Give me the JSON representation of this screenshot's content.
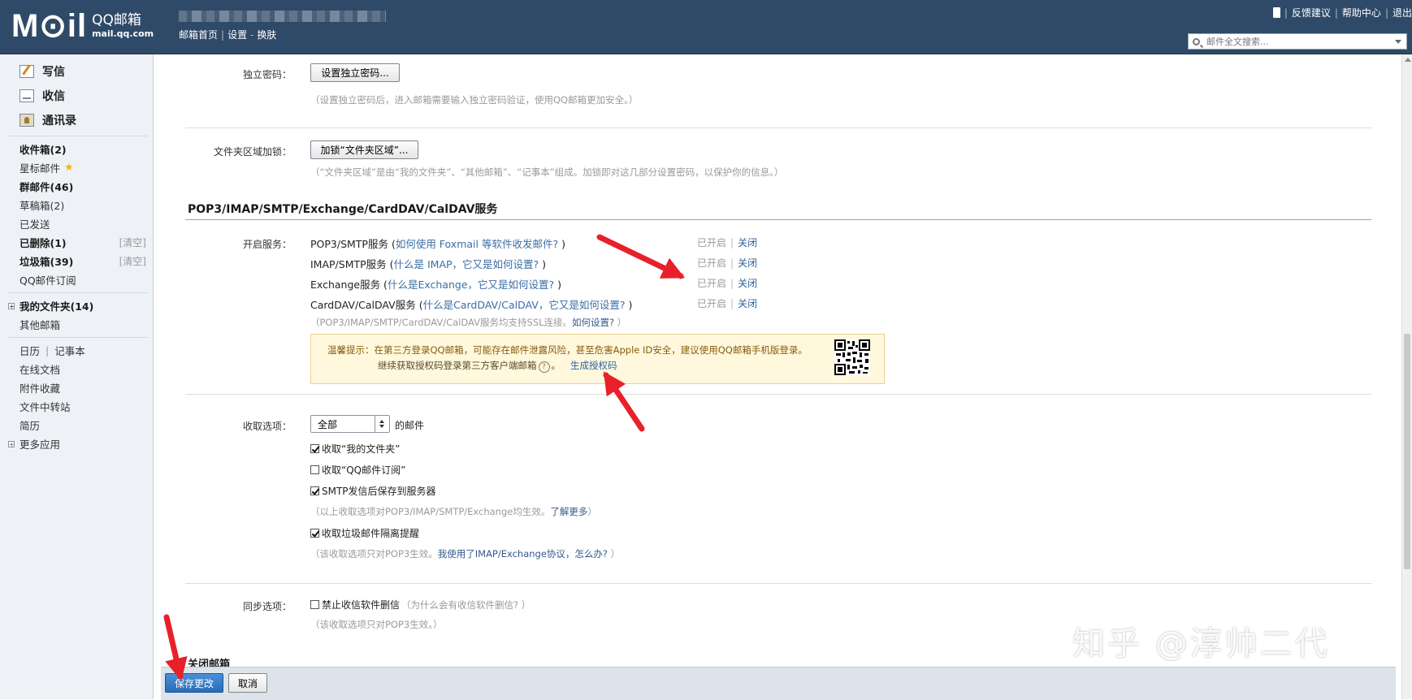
{
  "header": {
    "logo_mark": "M⊙il",
    "logo_title": "QQ邮箱",
    "logo_domain": "mail.qq.com",
    "nav_home": "邮箱首页",
    "nav_settings": "设置",
    "nav_skin": "换肤",
    "feedback": "反馈建议",
    "help": "帮助中心",
    "logout": "退出",
    "search_placeholder": "邮件全文搜索..."
  },
  "sidebar": {
    "primary": [
      {
        "label": "写信",
        "icon": "compose-icon"
      },
      {
        "label": "收信",
        "icon": "inbox-icon"
      },
      {
        "label": "通讯录",
        "icon": "contacts-icon"
      }
    ],
    "folders": [
      {
        "label": "收件箱(2)",
        "bold": true
      },
      {
        "label": "星标邮件",
        "bold": false
      },
      {
        "label": "群邮件(46)",
        "bold": true
      },
      {
        "label": "草稿箱(2)",
        "bold": false
      },
      {
        "label": "已发送",
        "bold": false
      },
      {
        "label": "已删除(1)",
        "bold": true,
        "clear": "[清空]"
      },
      {
        "label": "垃圾箱(39)",
        "bold": true,
        "clear": "[清空]"
      },
      {
        "label": "QQ邮件订阅",
        "bold": false
      }
    ],
    "my_folders": "我的文件夹(14)",
    "other_mail": "其他邮箱",
    "calendar": "日历",
    "notes": "记事本",
    "apps": [
      "在线文档",
      "附件收藏",
      "文件中转站",
      "简历"
    ],
    "more_apps": "更多应用"
  },
  "main": {
    "indep_pwd_label": "独立密码：",
    "indep_pwd_button": "设置独立密码...",
    "indep_pwd_hint": "（设置独立密码后，进入邮箱需要输入独立密码验证，使用QQ邮箱更加安全。）",
    "folder_lock_label": "文件夹区域加锁：",
    "folder_lock_button": "加锁“文件夹区域”...",
    "folder_lock_hint": "（“文件夹区域”是由“我的文件夹”、“其他邮箱”、“记事本”组成。加锁即对这几部分设置密码，以保护你的信息。）",
    "section_title": "POP3/IMAP/SMTP/Exchange/CardDAV/CalDAV服务",
    "services_label": "开启服务：",
    "services": [
      {
        "name": "POP3/SMTP服务 (",
        "link": "如何使用 Foxmail 等软件收发邮件?",
        "end": " )",
        "status": "已开启",
        "action": "关闭"
      },
      {
        "name": "IMAP/SMTP服务 (",
        "link": "什么是 IMAP，它又是如何设置?",
        "end": " )",
        "status": "已开启",
        "action": "关闭"
      },
      {
        "name": "Exchange服务 (",
        "link": "什么是Exchange，它又是如何设置?",
        "end": " )",
        "status": "已开启",
        "action": "关闭"
      },
      {
        "name": "CardDAV/CalDAV服务 (",
        "link": "什么是CardDAV/CalDAV，它又是如何设置?",
        "end": " )",
        "status": "已开启",
        "action": "关闭"
      }
    ],
    "ssl_hint": "（POP3/IMAP/SMTP/CardDAV/CalDAV服务均支持SSL连接。",
    "ssl_link": "如何设置?",
    "ssl_end": " ）",
    "tip_line1": "温馨提示：在第三方登录QQ邮箱，可能存在邮件泄露风险，甚至危害Apple ID安全，建议使用QQ邮箱手机版登录。",
    "tip_line2": "继续获取授权码登录第三方客户端邮箱",
    "tip_help": "?",
    "tip_period": "。",
    "tip_link": "生成授权码",
    "receive_label": "收取选项：",
    "receive_select": "全部",
    "receive_suffix": "的邮件",
    "checks": [
      {
        "label": "收取“我的文件夹”",
        "checked": true
      },
      {
        "label": "收取“QQ邮件订阅”",
        "checked": false
      },
      {
        "label": "SMTP发信后保存到服务器",
        "checked": true
      }
    ],
    "receive_hint": "（以上收取选项对POP3/IMAP/SMTP/Exchange均生效。",
    "receive_hint_link": "了解更多",
    "receive_hint_end": "）",
    "spam_check": "收取垃圾邮件隔离提醒",
    "spam_hint": "（该收取选项只对POP3生效。",
    "spam_hint_link": "我使用了IMAP/Exchange协议，怎么办?",
    "spam_hint_end": " ）",
    "sync_label": "同步选项：",
    "sync_check": "禁止收信软件删信",
    "sync_link": "（为什么会有收信软件删信?  ）",
    "sync_hint": "（该收取选项只对POP3生效。）",
    "close_title": "关闭邮箱"
  },
  "footer": {
    "save": "保存更改",
    "cancel": "取消"
  },
  "watermark": "知乎 @淳帅二代",
  "colors": {
    "topbar": "#2f4a68",
    "sidebar": "#eef2f7",
    "arrow": "#e8202a",
    "save": "#2a6bb8"
  }
}
